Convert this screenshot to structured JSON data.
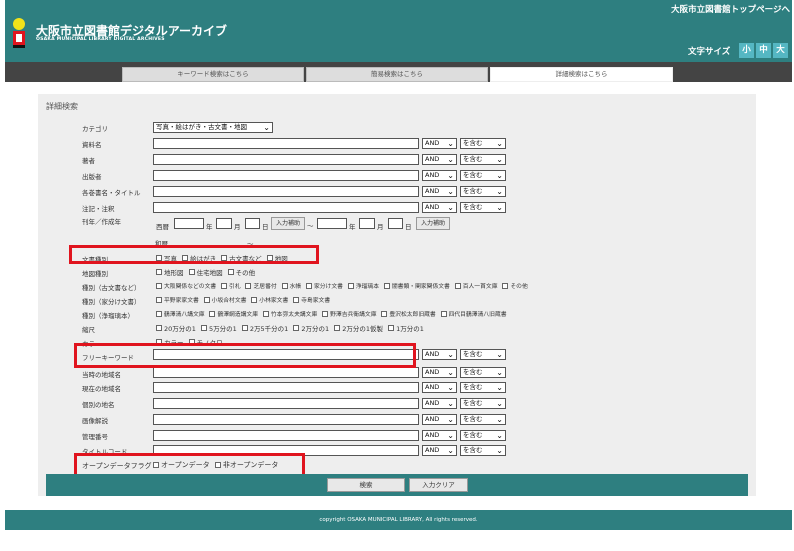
{
  "header": {
    "title": "大阪市立図書館デジタルアーカイブ",
    "subtitle": "OSAKA MUNICIPAL LIBRARY DIGITAL ARCHIVES",
    "top_link": "大阪市立図書館トップページへ",
    "font_size_label": "文字サイズ",
    "font_sizes": [
      "小",
      "中",
      "大"
    ]
  },
  "tabs": [
    {
      "label": "キーワード検索はこちら",
      "active": false
    },
    {
      "label": "簡易検索はこちら",
      "active": false
    },
    {
      "label": "詳細検索はこちら",
      "active": true
    }
  ],
  "panel": {
    "title": "詳細検索"
  },
  "options": {
    "andor": "AND",
    "contains": "を含む"
  },
  "fields": {
    "category": {
      "label": "カテゴリ",
      "value": "写真・絵はがき・古文書・地図"
    },
    "title": {
      "label": "資料名"
    },
    "author": {
      "label": "著者"
    },
    "publisher": {
      "label": "出版者"
    },
    "series": {
      "label": "各巻書名・タイトル"
    },
    "notes": {
      "label": "注記・注釈"
    },
    "date": {
      "label": "刊年／作成年",
      "era_label": "西暦",
      "era_label2": "和暦",
      "year": "年",
      "month": "月",
      "day": "日",
      "helper": "入力補助",
      "tilde": "～"
    },
    "doc_type": {
      "label": "文書種別",
      "options": [
        "写真",
        "絵はがき",
        "古文書など",
        "地図"
      ]
    },
    "map_type": {
      "label": "地図種別",
      "options": [
        "地形図",
        "住宅地図",
        "その他"
      ]
    },
    "kind_old": {
      "label": "種別（古文書など）",
      "options": [
        "大阪関係などの文書",
        "引札",
        "芝居番付",
        "水帳",
        "家分け文書",
        "浄瑠璃本",
        "闇書類・関家関係文書",
        "百人一首文庫",
        "その他"
      ]
    },
    "kind_house": {
      "label": "種別（家分け文書）",
      "options": [
        "平野家家文書",
        "小坂合村文書",
        "小林家文書",
        "寺島家文書"
      ]
    },
    "kind_joruri": {
      "label": "種別（浄瑠璃本）",
      "options": [
        "鶴澤清八講文庫",
        "鶴澤綱造講文庫",
        "竹本弥太夫講文庫",
        "野澤吉兵衛講文庫",
        "豊沢松太郎旧蔵書",
        "四代目鶴澤清八旧蔵書"
      ]
    },
    "scale": {
      "label": "縮尺",
      "options": [
        "20万分の1",
        "5万分の1",
        "2万5千分の1",
        "2万分の1",
        "2万分の1仮製",
        "1万分の1"
      ]
    },
    "color": {
      "label": "カラー",
      "options": [
        "カラー",
        "モノクロ"
      ]
    },
    "freeword": {
      "label": "フリーキーワード"
    },
    "place_old": {
      "label": "当時の地域名"
    },
    "place_now": {
      "label": "現在の地域名"
    },
    "place_each": {
      "label": "個別の地名"
    },
    "image_desc": {
      "label": "画像解説"
    },
    "mgmt_no": {
      "label": "管理番号"
    },
    "title_code": {
      "label": "タイトルコード"
    },
    "opendata": {
      "label": "オープンデータフラグ",
      "options": [
        "オープンデータ",
        "非オープンデータ"
      ]
    }
  },
  "actions": {
    "search": "検索",
    "clear": "入力クリア"
  },
  "footer": {
    "copyright": "copyright OSAKA MUNICIPAL LIBRARY, All rights reserved."
  },
  "colors": {
    "header": "#2e7f80",
    "accent": "#55b7c3",
    "highlight": "#e0141e",
    "tab_bar": "#444444"
  }
}
